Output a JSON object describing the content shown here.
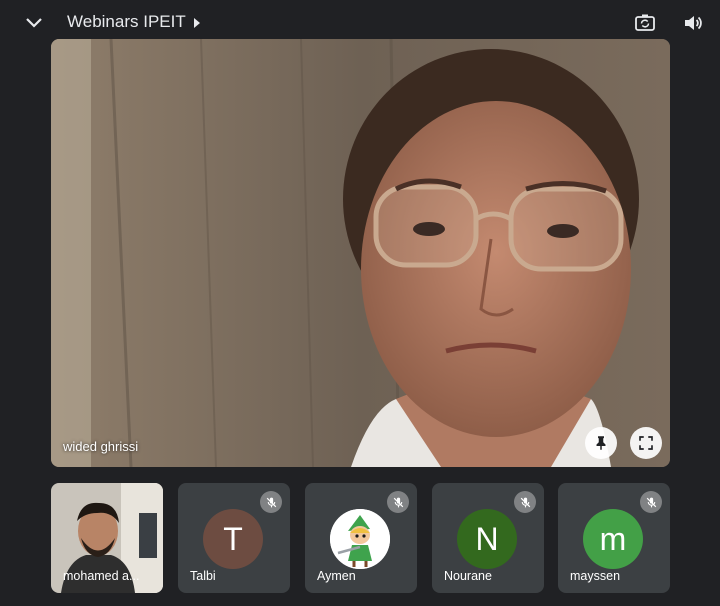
{
  "header": {
    "title": "Webinars IPEIT",
    "icons": [
      "chevron-down-icon",
      "caret-right-icon",
      "switch-camera-icon",
      "speaker-icon"
    ]
  },
  "main_video": {
    "participant_name": "wided ghrissi",
    "buttons": [
      "pin-icon",
      "fullscreen-icon"
    ]
  },
  "participants": [
    {
      "name": "mohamed a...",
      "type": "video"
    },
    {
      "name": "Talbi",
      "initial": "T",
      "avatar_color": "#6d4c41",
      "muted": true
    },
    {
      "name": "Aymen",
      "type": "image",
      "muted": true
    },
    {
      "name": "Nourane",
      "initial": "N",
      "avatar_color": "#33691e",
      "muted": true
    },
    {
      "name": "mayssen",
      "initial": "m",
      "avatar_color": "#43a047",
      "muted": true
    }
  ],
  "colors": {
    "background": "#202124",
    "tile_background": "#3c4043"
  }
}
